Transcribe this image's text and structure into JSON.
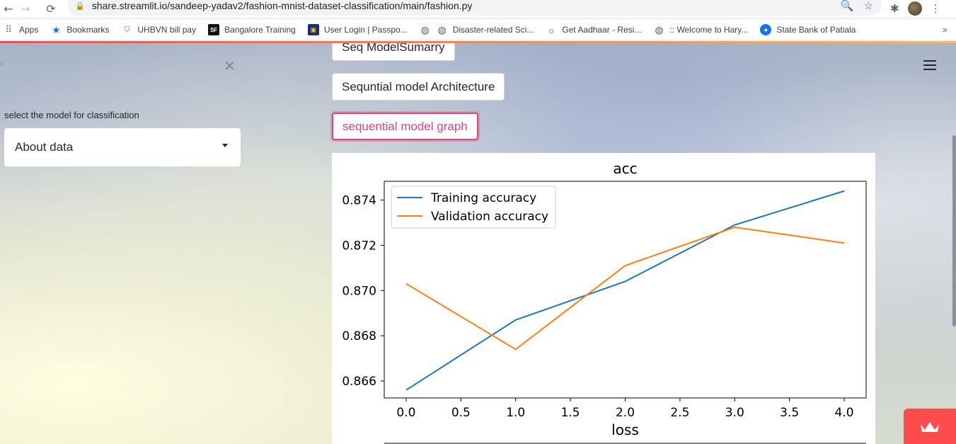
{
  "browser": {
    "url": "share.streamlit.io/sandeep-yadav2/fashion-mnist-dataset-classification/main/fashion.py",
    "bookmarks": [
      {
        "label": "Apps",
        "icon": "apps-grid-icon"
      },
      {
        "label": "Bookmarks",
        "icon": "star-icon"
      },
      {
        "label": "UHBVN bill pay",
        "icon": "uhbvn-icon"
      },
      {
        "label": "Bangalore Training",
        "icon": "sf-icon"
      },
      {
        "label": "User Login | Passpo...",
        "icon": "passport-icon"
      },
      {
        "label": "",
        "icon": "globe-icon"
      },
      {
        "label": "Disaster-related Sci...",
        "icon": "globe-icon"
      },
      {
        "label": "Get Aadhaar - Resi...",
        "icon": "aadhaar-icon"
      },
      {
        "label": ":: Welcome to Hary...",
        "icon": "globe-icon"
      },
      {
        "label": "State Bank of Patiala",
        "icon": "sbp-icon"
      }
    ]
  },
  "sidebar": {
    "select_label": "select the model for classification",
    "select_value": "About data"
  },
  "main": {
    "buttons": [
      {
        "label": "Seq ModelSumarry"
      },
      {
        "label": "Sequntial model Architecture"
      },
      {
        "label": "sequential model graph"
      }
    ]
  },
  "chart_data": [
    {
      "type": "line",
      "title": "acc",
      "x": [
        0,
        1,
        2,
        3,
        4
      ],
      "series": [
        {
          "name": "Training accuracy",
          "values": [
            0.8656,
            0.8687,
            0.8704,
            0.8729,
            0.8744
          ],
          "color": "#1f77b4"
        },
        {
          "name": "Validation accuracy",
          "values": [
            0.8703,
            0.8674,
            0.8711,
            0.8728,
            0.8721
          ],
          "color": "#ff7f0e"
        }
      ],
      "xticks": [
        "0.0",
        "0.5",
        "1.0",
        "1.5",
        "2.0",
        "2.5",
        "3.0",
        "3.5",
        "4.0"
      ],
      "yticks": [
        "0.866",
        "0.868",
        "0.870",
        "0.872",
        "0.874"
      ],
      "xlim": [
        -0.2,
        4.2
      ],
      "ylim": [
        0.86525,
        0.87483
      ],
      "legend": "upper-left"
    },
    {
      "type": "line",
      "title": "loss"
    }
  ]
}
